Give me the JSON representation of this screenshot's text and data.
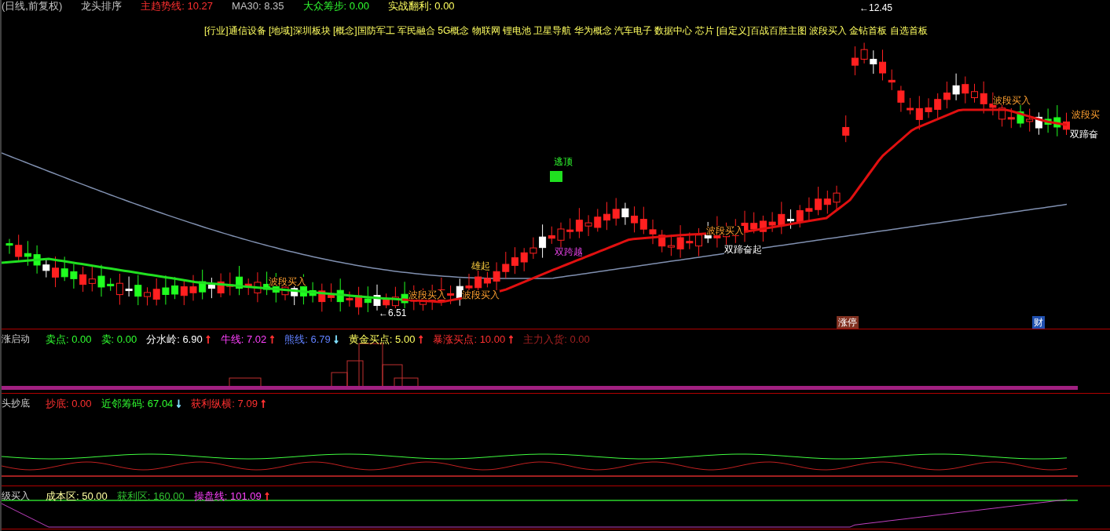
{
  "main_panel": {
    "top_line": [
      {
        "text": "(日线,前复权)",
        "color": "#c0c0c0"
      },
      {
        "text": "龙头排序",
        "color": "#c0c0c0"
      },
      {
        "text": "主趋势线: 10.27",
        "color": "#ff3030"
      },
      {
        "text": "MA30: 8.35",
        "color": "#c0c0c0"
      },
      {
        "text": "大众筹步: 0.00",
        "color": "#30ff30"
      },
      {
        "text": "实战翻利: 0.00",
        "color": "#ffff60"
      }
    ],
    "concepts": "[行业]通信设备 [地域]深圳板块 [概念]国防军工 军民融合 5G概念 物联网 锂电池 卫星导航 华为概念 汽车电子 数据中心 芯片 [自定义]百战百胜主图 波段买入 金钻首板 自选首板",
    "annotations": [
      {
        "kind": "price",
        "text": "←12.45"
      },
      {
        "kind": "price",
        "text": "←6.51"
      },
      {
        "kind": "top",
        "text": "逃顶"
      },
      {
        "kind": "cross",
        "text": "双跨越"
      },
      {
        "kind": "rise",
        "text": "双蹄奋起"
      },
      {
        "kind": "rise",
        "text": "双蹄奋"
      },
      {
        "kind": "buy",
        "text": "波段买入"
      },
      {
        "kind": "buy",
        "text": "波段买入"
      },
      {
        "kind": "buy",
        "text": "波段买入"
      },
      {
        "kind": "buy",
        "text": "波段买入"
      },
      {
        "kind": "buy",
        "text": "波段买入"
      },
      {
        "kind": "buy",
        "text": "波段买"
      },
      {
        "kind": "rise2",
        "text": "雄起"
      },
      {
        "kind": "limit",
        "text": "涨停"
      },
      {
        "kind": "finance",
        "text": "财"
      }
    ]
  },
  "sub_panels": [
    {
      "title": "涨启动",
      "indicators": [
        {
          "label": "卖点:",
          "value": "0.00",
          "color": "#30ff30"
        },
        {
          "label": "卖:",
          "value": "0.00",
          "color": "#30ff30"
        },
        {
          "label": "分水岭:",
          "value": "6.90",
          "arrow": {
            "text": "↑",
            "color": "#ff3030"
          },
          "color": "#ffffff"
        },
        {
          "label": "牛线:",
          "value": "7.02",
          "arrow": {
            "text": "↑",
            "color": "#ff3030"
          },
          "color": "#ff40ff"
        },
        {
          "label": "熊线:",
          "value": "6.79",
          "arrow": {
            "text": "↓",
            "color": "#80e0ff"
          },
          "color": "#6080ff"
        },
        {
          "label": "黄金买点:",
          "value": "5.00",
          "arrow": {
            "text": "↑",
            "color": "#ff3030"
          },
          "color": "#ffff60"
        },
        {
          "label": "暴涨买点:",
          "value": "10.00",
          "arrow": {
            "text": "↑",
            "color": "#ff3030"
          },
          "color": "#ff3030"
        },
        {
          "label": "主力入货:",
          "value": "0.00",
          "color": "#a02020"
        }
      ]
    },
    {
      "title": "头抄底",
      "indicators": [
        {
          "label": "抄底:",
          "value": "0.00",
          "color": "#ff3030"
        },
        {
          "label": "近邻筹码:",
          "value": "67.04",
          "arrow": {
            "text": "↓",
            "color": "#80e0ff"
          },
          "color": "#30ff30"
        },
        {
          "label": "获利纵横:",
          "value": "7.09",
          "arrow": {
            "text": "↑",
            "color": "#ff3030"
          },
          "color": "#ff3030"
        }
      ]
    },
    {
      "title": "级买入",
      "indicators": [
        {
          "label": "成本区:",
          "value": "50.00",
          "color": "#ffffa0"
        },
        {
          "label": "获利区:",
          "value": "160.00",
          "color": "#30c030"
        },
        {
          "label": "操盘线:",
          "value": "101.09",
          "arrow": {
            "text": "↑",
            "color": "#ff3030"
          },
          "color": "#ff40ff"
        }
      ]
    }
  ]
}
